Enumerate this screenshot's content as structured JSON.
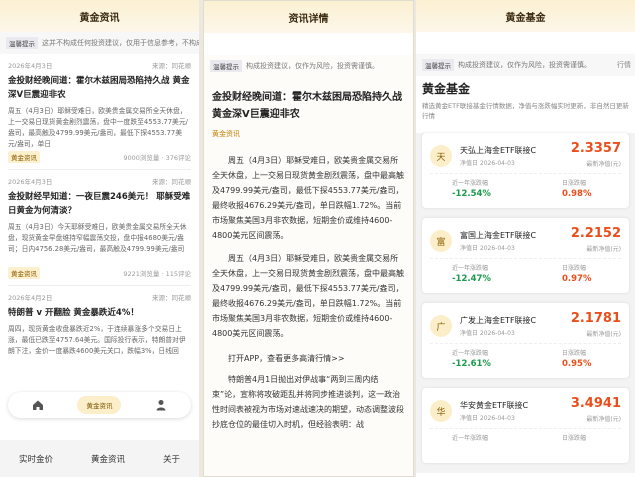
{
  "panel1": {
    "title": "黄金资讯",
    "notice": {
      "tag": "温馨提示",
      "text": "这并不构成任何投资建议，仅用于信息参考，不构成任何",
      "tail": "行情"
    },
    "news": [
      {
        "date": "2026年4月3日",
        "source": "来源：同花顺",
        "title": "金投财经晚间道：霍尔木兹困局恐陷持久战 黄金深V巨震迎非农",
        "body": "周五（4月3日）耶稣受难日，欧美贵金属交易所全天休盘，上一交易日现货黄金剧烈震荡，盘中一度跌至4553.77美元/盎司，最高触及4799.99美元/盎司，最低下探4553.77美元/盎司，单日",
        "tag": "黄金资讯",
        "views": "9000浏览量 · 376评论"
      },
      {
        "date": "2026年4月3日",
        "source": "来源：同花顺",
        "title": "金投财经早知道：一夜巨震246美元！ 耶稣受难日黄金为何清淡？",
        "body": "周五（4月3日）今天耶稣受难日，欧美贵金属交易所全天休盘，现货黄金早盘维持窄幅震荡交投，盘中报4680美元/盎司；日内4756.28美元/盎司，最高触及4799.99美元/盎司",
        "tag": "黄金资讯",
        "views": "9221浏览量 · 115评论"
      },
      {
        "date": "2026年4月2日",
        "source": "来源：同花顺",
        "title": "特朗普 v 开翻脸 黄金暴跌近4%！",
        "body": "周四，现货黄金收盘暴跌近2%，于连续暴涨多个交易日上涨，最低已跌至4757.64美元。国际投行表示，特朗普对伊朗下注，金价一度暴跌4600美元关口，跌幅3%，日线回",
        "tag": "黄金资讯",
        "views": ""
      }
    ],
    "tabbar": {
      "active": "黄金资讯"
    },
    "bottomnav": [
      "实时金价",
      "黄金资讯",
      "关于"
    ]
  },
  "panel2": {
    "title": "资讯详情",
    "notice": {
      "tag": "温馨提示",
      "text": "构成投资建议，仅作为风险，投资需谨慎。"
    },
    "headline": "金投财经晚间道：霍尔木兹困局恐陷持久战 黄金深V巨震迎非农",
    "source": "黄金资讯",
    "paragraphs": [
      "周五（4月3日）耶稣受难日，欧美贵金属交易所全天休盘，上一交易日现货黄金剧烈震荡，盘中最高触及4799.99美元/盎司，最低下探4553.77美元/盎司，最终收报4676.29美元/盎司，单日跌幅1.72%。当前市场聚焦美国3月非农数据，短期金价或维持4600-4800美元区间震荡。",
      "周五（4月3日）耶稣受难日，欧美贵金属交易所全天休盘，上一交易日现货黄金剧烈震荡，盘中最高触及4799.99美元/盎司，最低下探4553.77美元/盎司，最终收报4676.29美元/盎司，单日跌幅1.72%。当前市场聚焦美国3月非农数据，短期金价或维持4600-4800美元区间震荡。"
    ],
    "link": "打开APP，查看更多高清行情>>",
    "trailing": "特朗普4月1日抛出对伊战事“两到三周内结束”论，宣称将攻破距乱并将同步推进谈判，这一政治性时间表被视为市场对速战速决的期望，动态调整波段抄底仓位的最佳切入时机，但经验表明：战"
  },
  "panel3": {
    "title": "黄金基金",
    "notice": {
      "tag": "温馨提示",
      "text": "构成投资建议，仅作为风险，投资需谨慎。",
      "tail": "行情"
    },
    "heading": "黄金基金",
    "subtitle": "精选黄金ETF联接基金行情数据，净值与涨跌幅实时更新，非自然日更新行情",
    "funds": [
      {
        "avatar": "天",
        "name": "天弘上海金ETF联接C",
        "date": "净值日 2026-04-03",
        "nav": "2.3357",
        "nav_label": "最新净值(元)",
        "l1": "近一年涨跌幅",
        "l2": "日涨跌幅",
        "v1": "-12.54%",
        "v2": "0.98%"
      },
      {
        "avatar": "富",
        "name": "富国上海金ETF联接C",
        "date": "净值日 2026-04-03",
        "nav": "2.2152",
        "nav_label": "最新净值(元)",
        "l1": "近一年涨跌幅",
        "l2": "日涨跌幅",
        "v1": "-12.47%",
        "v2": "0.97%"
      },
      {
        "avatar": "广",
        "name": "广发上海金ETF联接C",
        "date": "净值日 2026-04-03",
        "nav": "2.1781",
        "nav_label": "最新净值(元)",
        "l1": "近一年涨跌幅",
        "l2": "日涨跌幅",
        "v1": "-12.61%",
        "v2": "0.95%"
      },
      {
        "avatar": "华",
        "name": "华安黄金ETF联接C",
        "date": "净值日 2026-04-03",
        "nav": "3.4941",
        "nav_label": "最新净值(元)",
        "l1": "近一年涨跌幅",
        "l2": "日涨跌幅",
        "v1": "",
        "v2": ""
      }
    ]
  },
  "colors": {
    "accent": "#e94e1b",
    "positive": "#e94e1b",
    "negative": "#1a9a4a",
    "gold": "#c57f00"
  }
}
